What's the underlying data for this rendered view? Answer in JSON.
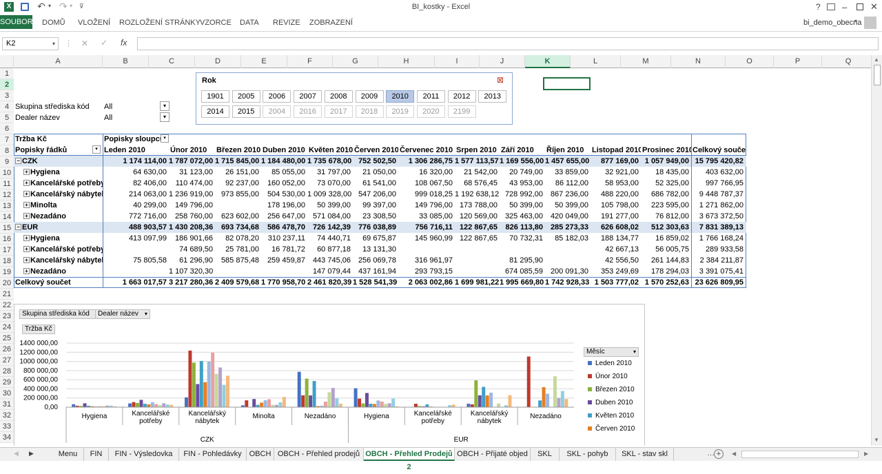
{
  "window": {
    "title": "BI_kostky - Excel",
    "help": "?",
    "user": "bi_demo_obecna"
  },
  "ribbon": {
    "file": "SOUBOR",
    "tabs": [
      "DOMŮ",
      "VLOŽENÍ",
      "ROZLOŽENÍ STRÁNKY",
      "VZORCE",
      "DATA",
      "REVIZE",
      "ZOBRAZENÍ"
    ]
  },
  "formula": {
    "namebox": "K2",
    "fx": "fx",
    "value": ""
  },
  "columns": [
    "A",
    "B",
    "C",
    "D",
    "E",
    "F",
    "G",
    "H",
    "I",
    "J",
    "K",
    "L",
    "M",
    "N",
    "O",
    "P",
    "Q"
  ],
  "rows": [
    "1",
    "2",
    "3",
    "4",
    "5",
    "6",
    "7",
    "8",
    "9",
    "10",
    "11",
    "12",
    "13",
    "14",
    "15",
    "16",
    "17",
    "18",
    "19",
    "20",
    "21",
    "22",
    "23",
    "24",
    "25",
    "26",
    "27",
    "28",
    "29",
    "30",
    "31",
    "32",
    "33",
    "34"
  ],
  "filters": {
    "f1_label": "Skupina střediska kód",
    "f1_value": "All",
    "f2_label": "Dealer název",
    "f2_value": "All"
  },
  "slicer": {
    "title": "Rok",
    "years": [
      "1901",
      "2005",
      "2006",
      "2007",
      "2008",
      "2009",
      "2010",
      "2011",
      "2012",
      "2013",
      "2014",
      "2015",
      "2004",
      "2016",
      "2017",
      "2018",
      "2019",
      "2020",
      "2199"
    ],
    "selected": "2010"
  },
  "pivot": {
    "value_label": "Tržba Kč",
    "col_label": "Popisky sloupců",
    "row_label": "Popisky řádků",
    "headers": [
      "Leden 2010",
      "Únor 2010",
      "Březen 2010",
      "Duben 2010",
      "Květen 2010",
      "Červen 2010",
      "Červenec 2010",
      "Srpen 2010",
      "Září 2010",
      "Říjen 2010",
      "Listopad 2010",
      "Prosinec 2010",
      "Celkový součet"
    ],
    "rows": [
      {
        "label": "CZK",
        "level": 0,
        "values": [
          "1 174 114,00",
          "1 787 072,00",
          "1 715 845,00",
          "1 184 480,00",
          "1 735 678,00",
          "752 502,50",
          "1 306 286,75",
          "1 577 113,57",
          "1 169 556,00",
          "1 457 655,00",
          "877 169,00",
          "1 057 949,00",
          "15 795 420,82"
        ]
      },
      {
        "label": "Hygiena",
        "level": 1,
        "values": [
          "64 630,00",
          "31 123,00",
          "26 151,00",
          "85 055,00",
          "31 797,00",
          "21 050,00",
          "16 320,00",
          "21 542,00",
          "20 749,00",
          "33 859,00",
          "32 921,00",
          "18 435,00",
          "403 632,00"
        ]
      },
      {
        "label": "Kancelářské potřeby",
        "level": 1,
        "values": [
          "82 406,00",
          "110 474,00",
          "92 237,00",
          "160 052,00",
          "73 070,00",
          "61 541,00",
          "108 067,50",
          "68 576,45",
          "43 953,00",
          "86 112,00",
          "58 953,00",
          "52 325,00",
          "997 766,95"
        ]
      },
      {
        "label": "Kancelářský nábytek",
        "level": 1,
        "values": [
          "214 063,00",
          "1 236 919,00",
          "973 855,00",
          "504 530,00",
          "1 009 328,00",
          "547 206,00",
          "999 018,25",
          "1 192 638,12",
          "728 992,00",
          "867 236,00",
          "488 220,00",
          "686 782,00",
          "9 448 787,37"
        ]
      },
      {
        "label": "Minolta",
        "level": 1,
        "values": [
          "40 299,00",
          "149 796,00",
          "",
          "178 196,00",
          "50 399,00",
          "99 397,00",
          "149 796,00",
          "173 788,00",
          "50 399,00",
          "50 399,00",
          "105 798,00",
          "223 595,00",
          "1 271 862,00"
        ]
      },
      {
        "label": "Nezadáno",
        "level": 1,
        "values": [
          "772 716,00",
          "258 760,00",
          "623 602,00",
          "256 647,00",
          "571 084,00",
          "23 308,50",
          "33 085,00",
          "120 569,00",
          "325 463,00",
          "420 049,00",
          "191 277,00",
          "76 812,00",
          "3 673 372,50"
        ]
      },
      {
        "label": "EUR",
        "level": 0,
        "values": [
          "488 903,57",
          "1 430 208,36",
          "693 734,68",
          "586 478,70",
          "726 142,39",
          "776 038,89",
          "756 716,11",
          "122 867,65",
          "826 113,80",
          "285 273,33",
          "626 608,02",
          "512 303,63",
          "7 831 389,13"
        ]
      },
      {
        "label": "Hygiena",
        "level": 1,
        "values": [
          "413 097,99",
          "186 901,66",
          "82 078,20",
          "310 237,11",
          "74 440,71",
          "69 675,87",
          "145 960,99",
          "122 867,65",
          "70 732,31",
          "85 182,03",
          "188 134,77",
          "16 859,02",
          "1 766 168,24"
        ]
      },
      {
        "label": "Kancelářské potřeby",
        "level": 1,
        "values": [
          "",
          "74 689,50",
          "25 781,00",
          "16 781,72",
          "60 877,18",
          "13 131,30",
          "",
          "",
          "",
          "",
          "42 667,13",
          "56 005,75",
          "289 933,58"
        ]
      },
      {
        "label": "Kancelářský nábytek",
        "level": 1,
        "values": [
          "75 805,58",
          "61 296,90",
          "585 875,48",
          "259 459,87",
          "443 745,06",
          "256 069,78",
          "316 961,97",
          "",
          "81 295,90",
          "",
          "42 556,50",
          "261 144,83",
          "2 384 211,87"
        ]
      },
      {
        "label": "Nezadáno",
        "level": 1,
        "values": [
          "",
          "1 107 320,30",
          "",
          "",
          "147 079,44",
          "437 161,94",
          "293 793,15",
          "",
          "674 085,59",
          "200 091,30",
          "353 249,69",
          "178 294,03",
          "3 391 075,41"
        ]
      },
      {
        "label": "Celkový součet",
        "level": 2,
        "values": [
          "1 663 017,57",
          "3 217 280,36",
          "2 409 579,68",
          "1 770 958,70",
          "2 461 820,39",
          "1 528 541,39",
          "2 063 002,86",
          "1 699 981,22",
          "1 995 669,80",
          "1 742 928,33",
          "1 503 777,02",
          "1 570 252,63",
          "23 626 809,95"
        ]
      }
    ]
  },
  "chart_data": {
    "type": "bar",
    "filter_buttons": [
      "Skupina střediska kód",
      "Dealer název"
    ],
    "value_button": "Tržba Kč",
    "yticks": [
      "1400 000,00",
      "1200 000,00",
      "1000 000,00",
      "800 000,00",
      "600 000,00",
      "400 000,00",
      "200 000,00",
      "0,00"
    ],
    "ylim": [
      0,
      1400000
    ],
    "groups": [
      {
        "name": "CZK",
        "categories": [
          "Hygiena",
          "Kancelářské potřeby",
          "Kancelářský nábytek",
          "Minolta",
          "Nezadáno"
        ]
      },
      {
        "name": "EUR",
        "categories": [
          "Hygiena",
          "Kancelářské potřeby",
          "Kancelářský nábytek",
          "Nezadáno"
        ]
      }
    ],
    "legend_title": "Měsíc",
    "legend_placement": "right",
    "series": [
      {
        "name": "Leden 2010",
        "color": "#4472c4",
        "values": [
          64630,
          82406,
          214063,
          40299,
          772716,
          413098,
          0,
          75806,
          0
        ]
      },
      {
        "name": "Únor 2010",
        "color": "#c0392b",
        "values": [
          31123,
          110474,
          1236919,
          149796,
          258760,
          186902,
          74690,
          61297,
          1107320
        ]
      },
      {
        "name": "Březen 2010",
        "color": "#8bb33a",
        "values": [
          26151,
          92237,
          973855,
          0,
          623602,
          82078,
          25781,
          585875,
          0
        ]
      },
      {
        "name": "Duben 2010",
        "color": "#6a4c9c",
        "values": [
          85055,
          160052,
          504530,
          178196,
          256647,
          310237,
          16782,
          259460,
          0
        ]
      },
      {
        "name": "Květen 2010",
        "color": "#3fa0c7",
        "values": [
          31797,
          73070,
          1009328,
          50399,
          571084,
          74441,
          60877,
          443745,
          147079
        ]
      },
      {
        "name": "Červen 2010",
        "color": "#e67e22",
        "values": [
          21050,
          61541,
          547206,
          99397,
          23309,
          69676,
          13131,
          256070,
          437162
        ]
      },
      {
        "name": "Červenec 2010",
        "color": "#9cb8e0",
        "values": [
          16320,
          108068,
          999018,
          149796,
          33085,
          145961,
          0,
          316962,
          293793
        ]
      },
      {
        "name": "Srpen 2010",
        "color": "#e8a0a0",
        "values": [
          21542,
          68576,
          1192638,
          173788,
          120569,
          122868,
          0,
          0,
          0
        ]
      },
      {
        "name": "Září 2010",
        "color": "#c5d99a",
        "values": [
          20749,
          43953,
          728992,
          50399,
          325463,
          70732,
          0,
          81296,
          674086
        ]
      },
      {
        "name": "Říjen 2010",
        "color": "#b3a2cc",
        "values": [
          33859,
          86112,
          867236,
          50399,
          420049,
          85182,
          0,
          0,
          200091
        ]
      },
      {
        "name": "Listopad 2010",
        "color": "#8fcfe3",
        "values": [
          32921,
          58953,
          488220,
          105798,
          191277,
          188135,
          42667,
          42557,
          353250
        ]
      },
      {
        "name": "Prosinec 2010",
        "color": "#f5b97a",
        "values": [
          18435,
          52325,
          686782,
          223595,
          76812,
          16859,
          56006,
          261145,
          178294
        ]
      }
    ]
  },
  "sheets": [
    "Menu",
    "FIN",
    "FIN - Výsledovka",
    "FIN - Pohledávky",
    "OBCH",
    "OBCH - Přehled prodejů",
    "OBCH - Přehled Prodejů 2",
    "OBCH - Přijaté objed",
    "SKL",
    "SKL - pohyb",
    "SKL - stav skl"
  ]
}
